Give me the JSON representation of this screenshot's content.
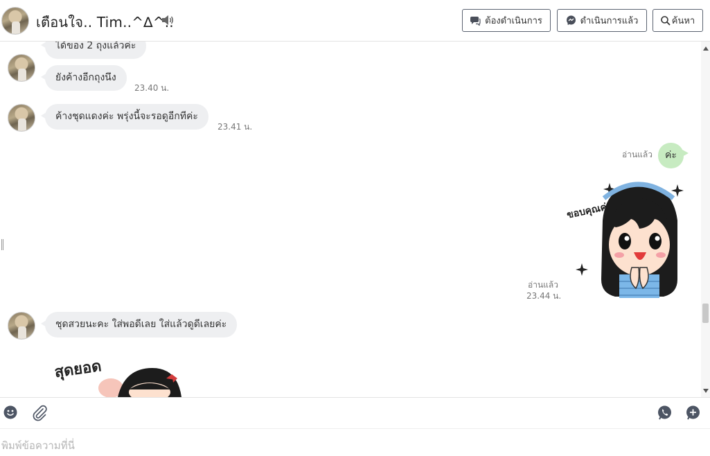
{
  "header": {
    "title": "เตือนใจ.. Tim..^∆^..",
    "btn_todo": "ต้องดำเนินการ",
    "btn_done": "ดำเนินการแล้ว",
    "btn_search": "ค้นหา"
  },
  "messages": [
    {
      "direction": "in",
      "text": "ได้ของ 2 ถุงแล้วค่ะ",
      "time": ""
    },
    {
      "direction": "in",
      "text": "ยังค้างอีกถุงนึง",
      "time": "23.40 น."
    },
    {
      "direction": "in",
      "text": "ค้างชุดแดงค่ะ พรุ่งนี้จะรอดูอีกทีค่ะ",
      "time": "23.41 น."
    },
    {
      "direction": "out",
      "text": "ค่ะ",
      "read": "อ่านแล้ว"
    },
    {
      "direction": "out",
      "type": "sticker",
      "sticker_text": "ขอบคุณค่า",
      "read": "อ่านแล้ว",
      "time": "23.44 น."
    },
    {
      "direction": "in",
      "text": "ชุดสวยนะคะ  ใส่พอดีเลย  ใส่แล้วดูดีเลยค่ะ",
      "time": ""
    },
    {
      "direction": "in",
      "type": "sticker",
      "sticker_text": "สุดยอด"
    }
  ],
  "composer": {
    "placeholder": "พิมพ์ข้อความที่นี่"
  },
  "icons": {
    "speaker": "speaker-icon",
    "todo": "chat-bubble-icon",
    "done": "messenger-icon",
    "search": "search-icon",
    "emoji": "smiley-icon",
    "attach": "paperclip-icon",
    "call": "phone-icon",
    "add": "plus-chat-icon"
  },
  "colors": {
    "incoming_bubble": "#eeeff1",
    "outgoing_bubble": "#c7ebc1",
    "button_border": "#5a6270"
  }
}
